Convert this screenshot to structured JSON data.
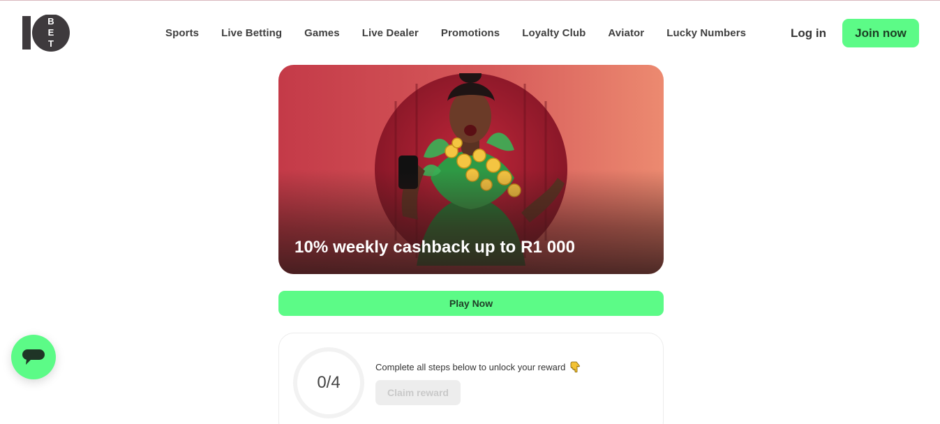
{
  "brand": {
    "logo_text": "10BET",
    "accent": "#5cfb87",
    "logo_color": "#3e3a3d"
  },
  "nav": {
    "items": [
      {
        "label": "Sports"
      },
      {
        "label": "Live Betting"
      },
      {
        "label": "Games"
      },
      {
        "label": "Live Dealer"
      },
      {
        "label": "Promotions"
      },
      {
        "label": "Loyalty Club"
      },
      {
        "label": "Aviator"
      },
      {
        "label": "Lucky Numbers"
      }
    ]
  },
  "auth": {
    "login_label": "Log in",
    "join_label": "Join now"
  },
  "banner": {
    "title": "10% weekly cashback up to R1 000"
  },
  "cta": {
    "play_label": "Play Now"
  },
  "progress": {
    "completed": 0,
    "total": 4,
    "display": "0/4",
    "instruction": "Complete all steps below to unlock your reward",
    "claim_label": "Claim reward",
    "instruction_icon": "pointing-down-hand-icon"
  },
  "chat": {
    "icon": "chat-bubble-icon"
  }
}
